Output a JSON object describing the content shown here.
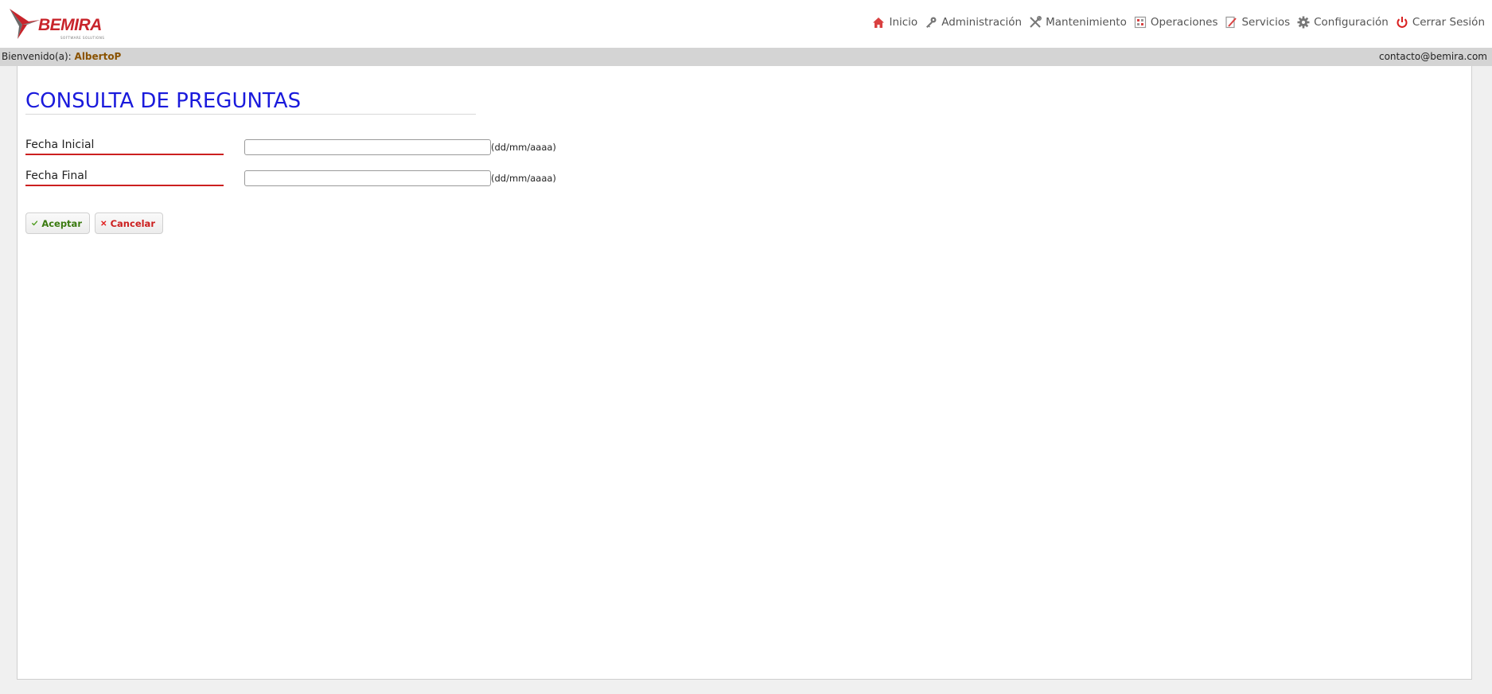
{
  "brand": {
    "name": "BEMIRA",
    "tagline": "SOFTWARE SOLUTIONS",
    "color": "#c8242b"
  },
  "nav": {
    "items": [
      {
        "label": "Inicio",
        "icon": "home-icon"
      },
      {
        "label": "Administración",
        "icon": "key-icon"
      },
      {
        "label": "Mantenimiento",
        "icon": "tools-icon"
      },
      {
        "label": "Operaciones",
        "icon": "calculator-icon"
      },
      {
        "label": "Servicios",
        "icon": "edit-document-icon"
      },
      {
        "label": "Configuración",
        "icon": "gear-icon"
      },
      {
        "label": "Cerrar Sesión",
        "icon": "power-icon"
      }
    ]
  },
  "welcome": {
    "prefix": "Bienvenido(a):",
    "user": "AlbertoP",
    "email": "contacto@bemira.com"
  },
  "page": {
    "title": "CONSULTA DE PREGUNTAS"
  },
  "form": {
    "fields": [
      {
        "label": "Fecha Inicial",
        "value": "",
        "hint": "(dd/mm/aaaa)"
      },
      {
        "label": "Fecha Final",
        "value": "",
        "hint": "(dd/mm/aaaa)"
      }
    ]
  },
  "buttons": {
    "accept": "Aceptar",
    "cancel": "Cancelar"
  },
  "colors": {
    "title": "#1a1adc",
    "accent_red": "#cc2020",
    "accept_green": "#3a7a10",
    "user_name": "#8a5200"
  }
}
